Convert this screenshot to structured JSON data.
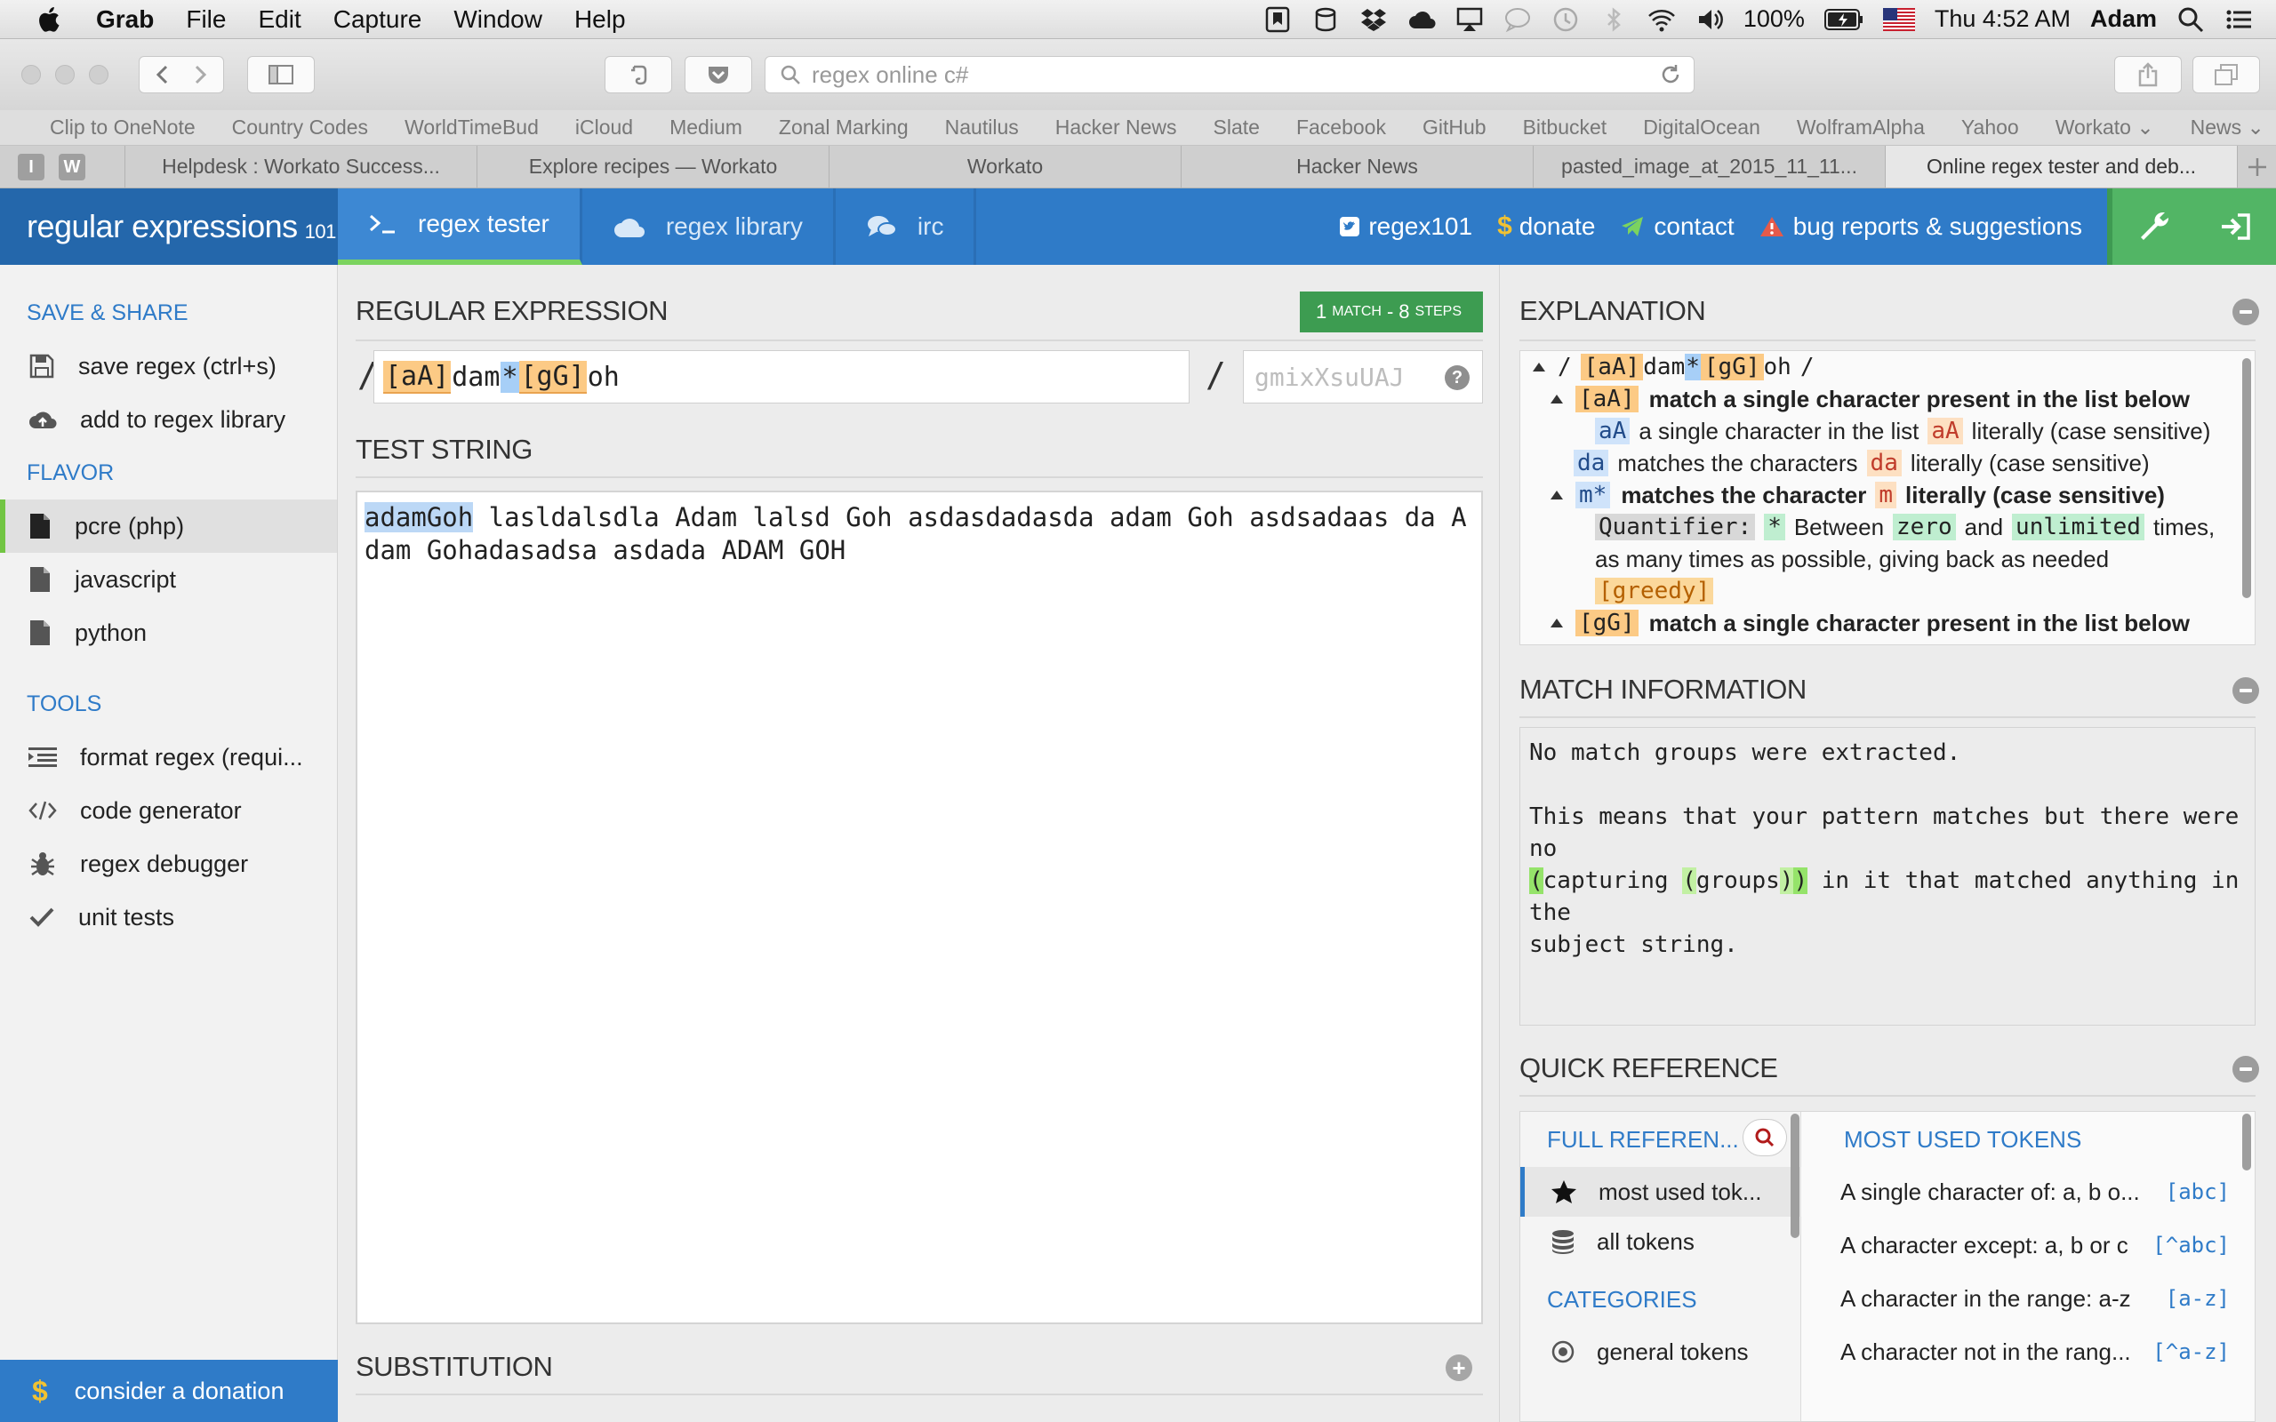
{
  "menubar": {
    "app": "Grab",
    "items": [
      "File",
      "Edit",
      "Capture",
      "Window",
      "Help"
    ],
    "battery": "100%",
    "clock": "Thu 4:52 AM",
    "user": "Adam"
  },
  "toolbar": {
    "url_placeholder": "regex online c#"
  },
  "bookmarks": [
    "Clip to OneNote",
    "Country Codes",
    "WorldTimeBud",
    "iCloud",
    "Medium",
    "Zonal Marking",
    "Nautilus",
    "Hacker News",
    "Slate",
    "Facebook",
    "GitHub",
    "Bitbucket",
    "DigitalOcean",
    "WolframAlpha",
    "Yahoo",
    "Workato ⌄",
    "News ⌄"
  ],
  "tabs": {
    "pinned": [
      "I",
      "W"
    ],
    "items": [
      "Helpdesk : Workato Success...",
      "Explore recipes — Workato",
      "Workato",
      "Hacker News",
      "pasted_image_at_2015_11_11...",
      "Online regex tester and deb..."
    ]
  },
  "header": {
    "logo_main": "regular expressions",
    "logo_sub": "101",
    "nav": [
      "regex tester",
      "regex library",
      "irc"
    ],
    "links": [
      "regex101",
      "donate",
      "contact",
      "bug reports & suggestions"
    ]
  },
  "sidebar": {
    "save_head": "SAVE & SHARE",
    "save_items": [
      "save regex (ctrl+s)",
      "add to regex library"
    ],
    "flavor_head": "FLAVOR",
    "flavors": [
      "pcre (php)",
      "javascript",
      "python"
    ],
    "tools_head": "TOOLS",
    "tools": [
      "format regex (requi...",
      "code generator",
      "regex debugger",
      "unit tests"
    ],
    "donate": "consider a donation"
  },
  "regex": {
    "title": "REGULAR EXPRESSION",
    "match_count": "1",
    "match_word": "MATCH",
    "steps_sep": "-",
    "steps": "8",
    "steps_word": "STEPS",
    "delim": "/",
    "tokens": [
      "[aA]",
      "dam",
      "*",
      "[gG]",
      "oh"
    ],
    "flags_placeholder": "gmixXsuUAJ",
    "help": "?"
  },
  "test": {
    "title": "TEST STRING",
    "match": "adamGoh",
    "rest": " lasldalsdla Adam lalsd Goh asdasdadasda adam Goh asdsadaas da Adam Gohadasadsa asdada ADAM GOH"
  },
  "substitution": {
    "title": "SUBSTITUTION"
  },
  "explanation": {
    "title": "EXPLANATION",
    "r0": {
      "slash1": "/",
      "cls1": "[aA]",
      "lit": "dam",
      "quant": "*",
      "cls2": "[gG]",
      "tail": "oh",
      "slash2": "/"
    },
    "r1": {
      "tok": "[aA]",
      "desc": "match a single character present in the list below"
    },
    "r2": {
      "tok": "aA",
      "desc": "a single character in the list",
      "tok2": "aA",
      "desc2": "literally (case sensitive)"
    },
    "r3": {
      "tok": "da",
      "desc": "matches the characters",
      "tok2": "da",
      "desc2": "literally (case sensitive)"
    },
    "r4": {
      "tok": "m*",
      "desc": "matches the character",
      "tok2": "m",
      "desc2": "literally (case sensitive)"
    },
    "r5": {
      "q": "Quantifier:",
      "star": "*",
      "between": "Between",
      "zero": "zero",
      "and": "and",
      "unl": "unlimited",
      "times": "times,"
    },
    "r6": "as many times as possible, giving back as needed",
    "r7": "[greedy]",
    "r8": {
      "tok": "[gG]",
      "desc": "match a single character present in the list below"
    }
  },
  "matchinfo": {
    "title": "MATCH INFORMATION",
    "line1": "No match groups were extracted.",
    "line2": "This means that your pattern matches but there were no",
    "p_open": "(",
    "w_capturing": "capturing ",
    "p_open2": "(",
    "w_groups": "groups",
    "p_close": ")",
    "p_close2": ")",
    "line3_rest": " in it that matched anything in the",
    "line4": "subject string."
  },
  "quickref": {
    "title": "QUICK REFERENCE",
    "full_ref": "FULL REFEREN...",
    "items": [
      "most used tok...",
      "all tokens"
    ],
    "cat_head": "CATEGORIES",
    "categories": [
      "general tokens"
    ],
    "most_used_head": "MOST USED TOKENS",
    "rows": [
      {
        "desc": "A single character of: a, b o...",
        "tok": "[abc]"
      },
      {
        "desc": "A character except: a, b or c",
        "tok": "[^abc]"
      },
      {
        "desc": "A character in the range: a-z",
        "tok": "[a-z]"
      },
      {
        "desc": "A character not in the rang...",
        "tok": "[^a-z]"
      }
    ]
  },
  "colors": {
    "brand_blue": "#2f7bc8",
    "match_green": "#3d9c51",
    "tools_green": "#52b565"
  }
}
